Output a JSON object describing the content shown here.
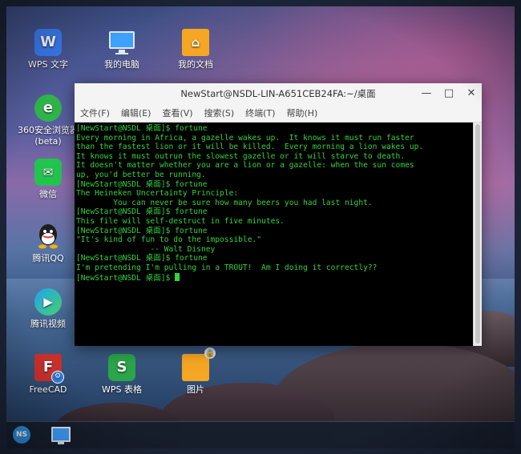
{
  "desktop": {
    "icons": [
      {
        "label": "WPS 文字",
        "glyph": "W",
        "icon": "wps-writer-icon",
        "color": "#3b7cf0"
      },
      {
        "label": "我的电脑",
        "glyph": "",
        "icon": "computer-icon",
        "color": "#3ea1ff"
      },
      {
        "label": "我的文档",
        "glyph": "⌂",
        "icon": "documents-folder-icon",
        "color": "#f5a623"
      },
      {
        "label": "360安全浏览器 (beta)",
        "glyph": "e",
        "icon": "360-browser-icon",
        "color": "#2fb34a"
      },
      {
        "label": "微信",
        "glyph": "✉",
        "icon": "wechat-icon",
        "color": "#23c350"
      },
      {
        "label": "腾讯QQ",
        "glyph": "Q",
        "icon": "qq-icon",
        "color": "#1e1e1e"
      },
      {
        "label": "腾讯视频",
        "glyph": "▶",
        "icon": "tencent-video-icon",
        "color": "#21a0f5"
      },
      {
        "label": "FreeCAD",
        "glyph": "F",
        "icon": "freecad-icon",
        "color": "#c9302c"
      },
      {
        "label": "WPS 表格",
        "glyph": "S",
        "icon": "wps-spreadsheet-icon",
        "color": "#2aa54a"
      },
      {
        "label": "图片",
        "glyph": "",
        "icon": "pictures-folder-icon",
        "color": "#f5a623"
      }
    ]
  },
  "window": {
    "title": "NewStart@NSDL-LIN-A651CEB24FA:~/桌面",
    "controls": {
      "minimize": "—",
      "maximize": "□",
      "close": "✕"
    },
    "menu": [
      "文件(F)",
      "编辑(E)",
      "查看(V)",
      "搜索(S)",
      "终端(T)",
      "帮助(H)"
    ]
  },
  "terminal": {
    "lines": [
      "[NewStart@NSDL 桌面]$ fortune",
      "Every morning in Africa, a gazelle wakes up.  It knows it must run faster",
      "than the fastest lion or it will be killed.  Every morning a lion wakes up.",
      "It knows it must outrun the slowest gazelle or it will starve to death.",
      "It doesn't matter whether you are a lion or a gazelle: when the sun comes",
      "up, you'd better be running.",
      "[NewStart@NSDL 桌面]$ fortune",
      "The Heineken Uncertainty Principle:",
      "        You can never be sure how many beers you had last night.",
      "[NewStart@NSDL 桌面]$ fortune",
      "This file will self-destruct in five minutes.",
      "[NewStart@NSDL 桌面]$ fortune",
      "\"It's kind of fun to do the impossible.\"",
      "                -- Walt Disney",
      "[NewStart@NSDL 桌面]$ fortune",
      "I'm pretending I'm pulling in a TROUT!  Am I doing it correctly??"
    ],
    "prompt": "[NewStart@NSDL 桌面]$ "
  },
  "taskbar": {
    "start_label": "NS",
    "items": [
      {
        "icon": "computer-icon"
      }
    ]
  }
}
